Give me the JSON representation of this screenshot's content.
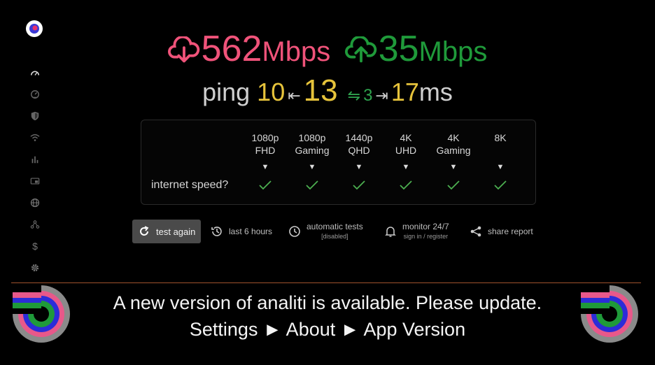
{
  "sidebar": {
    "items": [
      {
        "icon": "speedometer-icon"
      },
      {
        "icon": "gauge-icon"
      },
      {
        "icon": "shield-icon"
      },
      {
        "icon": "wifi-icon"
      },
      {
        "icon": "bar-chart-icon"
      },
      {
        "icon": "video-icon"
      },
      {
        "icon": "globe-icon"
      },
      {
        "icon": "network-icon"
      },
      {
        "icon": "dollar-icon"
      },
      {
        "icon": "gear-icon"
      }
    ]
  },
  "speed": {
    "download_value": "562",
    "download_unit": "Mbps",
    "upload_value": "35",
    "upload_unit": "Mbps"
  },
  "ping": {
    "label": "ping",
    "low": "10",
    "mid": "13",
    "jitter": "3",
    "high": "17",
    "unit": "ms"
  },
  "quality": {
    "row_label": "internet speed?",
    "columns": [
      {
        "line1": "1080p",
        "line2": "FHD"
      },
      {
        "line1": "1080p",
        "line2": "Gaming"
      },
      {
        "line1": "1440p",
        "line2": "QHD"
      },
      {
        "line1": "4K",
        "line2": "UHD"
      },
      {
        "line1": "4K",
        "line2": "Gaming"
      },
      {
        "line1": "8K",
        "line2": ""
      }
    ]
  },
  "actions": {
    "test_again": "test again",
    "last_hours": "last 6 hours",
    "automatic_tests": "automatic tests",
    "automatic_status": "[disabled]",
    "monitor": "monitor 24/7",
    "monitor_sub": "sign in / register",
    "share": "share report"
  },
  "banner": {
    "line1": "A new version of analiti is available. Please update.",
    "line2": "Settings ► About ► App Version"
  },
  "colors": {
    "download": "#f0537a",
    "upload": "#1f9a3a",
    "ping_accent": "#e6c33b",
    "check": "#4caf50",
    "banner_rule": "#a0522d"
  }
}
